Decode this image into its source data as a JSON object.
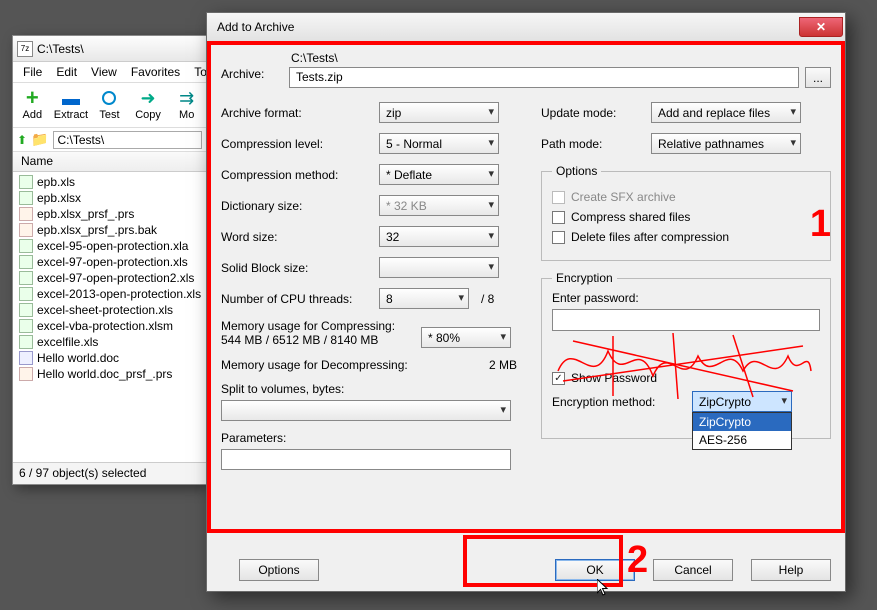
{
  "fm": {
    "title": "C:\\Tests\\",
    "menu": [
      "File",
      "Edit",
      "View",
      "Favorites",
      "To"
    ],
    "toolbar": [
      "Add",
      "Extract",
      "Test",
      "Copy",
      "Mo"
    ],
    "path": "C:\\Tests\\",
    "list_header": "Name",
    "files": [
      {
        "name": "epb.xls",
        "t": "xls"
      },
      {
        "name": "epb.xlsx",
        "t": "xls"
      },
      {
        "name": "epb.xlsx_prsf_.prs",
        "t": "prs"
      },
      {
        "name": "epb.xlsx_prsf_.prs.bak",
        "t": "prs"
      },
      {
        "name": "excel-95-open-protection.xla",
        "t": "xls"
      },
      {
        "name": "excel-97-open-protection.xls",
        "t": "xls"
      },
      {
        "name": "excel-97-open-protection2.xls",
        "t": "xls"
      },
      {
        "name": "excel-2013-open-protection.xls",
        "t": "xls"
      },
      {
        "name": "excel-sheet-protection.xls",
        "t": "xls"
      },
      {
        "name": "excel-vba-protection.xlsm",
        "t": "xls"
      },
      {
        "name": "excelfile.xls",
        "t": "xls"
      },
      {
        "name": "Hello world.doc",
        "t": "doc"
      },
      {
        "name": "Hello world.doc_prsf_.prs",
        "t": "prs"
      }
    ],
    "status": "6 / 97 object(s) selected"
  },
  "dlg": {
    "title": "Add to Archive",
    "archive_label": "Archive:",
    "archive_dir": "C:\\Tests\\",
    "archive_name": "Tests.zip",
    "browse": "...",
    "left": {
      "format_label": "Archive format:",
      "format_value": "zip",
      "level_label": "Compression level:",
      "level_value": "5 - Normal",
      "method_label": "Compression method:",
      "method_value": "* Deflate",
      "dict_label": "Dictionary size:",
      "dict_value": "* 32 KB",
      "word_label": "Word size:",
      "word_value": "32",
      "block_label": "Solid Block size:",
      "block_value": "",
      "cpu_label": "Number of CPU threads:",
      "cpu_value": "8",
      "cpu_max": "/ 8",
      "memc_label": "Memory usage for Compressing:",
      "memc_text": "544 MB / 6512 MB / 8140 MB",
      "memc_combo": "* 80%",
      "memd_label": "Memory usage for Decompressing:",
      "memd_value": "2 MB",
      "split_label": "Split to volumes, bytes:",
      "param_label": "Parameters:"
    },
    "right": {
      "update_label": "Update mode:",
      "update_value": "Add and replace files",
      "path_label": "Path mode:",
      "path_value": "Relative pathnames",
      "options_legend": "Options",
      "opt_sfx": "Create SFX archive",
      "opt_shared": "Compress shared files",
      "opt_delete": "Delete files after compression",
      "enc_legend": "Encryption",
      "enter_pw": "Enter password:",
      "show_pw": "Show Password",
      "enc_method_label": "Encryption method:",
      "enc_method_value": "ZipCrypto",
      "enc_options": [
        "ZipCrypto",
        "AES-256"
      ]
    },
    "buttons": {
      "options": "Options",
      "ok": "OK",
      "cancel": "Cancel",
      "help": "Help"
    }
  },
  "annotations": {
    "one": "1",
    "two": "2"
  }
}
